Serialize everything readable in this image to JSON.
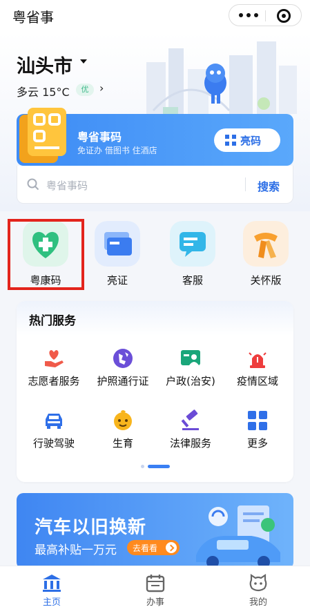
{
  "app": {
    "title": "粤省事"
  },
  "location": {
    "city": "汕头市",
    "weather": "多云 15°C",
    "air_quality": "优",
    "more": "›"
  },
  "code_card": {
    "title": "粤省事码",
    "subtitle": "免证办 借图书 住酒店",
    "button": "亮码"
  },
  "search": {
    "placeholder": "粤省事码",
    "button": "搜索"
  },
  "quick_actions": [
    {
      "label": "粤康码",
      "icon": "health-code-icon"
    },
    {
      "label": "亮证",
      "icon": "id-cards-icon"
    },
    {
      "label": "客服",
      "icon": "chat-icon"
    },
    {
      "label": "关怀版",
      "icon": "scarf-icon"
    }
  ],
  "hot_services": {
    "title": "热门服务",
    "items": [
      {
        "label": "志愿者服务",
        "icon": "heart-hand-icon"
      },
      {
        "label": "护照通行证",
        "icon": "passport-icon"
      },
      {
        "label": "户政(治安)",
        "icon": "household-icon"
      },
      {
        "label": "疫情区域",
        "icon": "alarm-light-icon"
      },
      {
        "label": "行驶驾驶",
        "icon": "car-icon"
      },
      {
        "label": "生育",
        "icon": "baby-icon"
      },
      {
        "label": "法律服务",
        "icon": "gavel-icon"
      },
      {
        "label": "更多",
        "icon": "grid-icon"
      }
    ]
  },
  "banner": {
    "title": "汽车以旧换新",
    "subtitle": "最高补贴一万元",
    "button": "去看看"
  },
  "tabs": [
    {
      "label": "主页",
      "active": true
    },
    {
      "label": "办事",
      "active": false
    },
    {
      "label": "我的",
      "active": false
    }
  ],
  "colors": {
    "accent": "#2d6fe6",
    "highlight": "#e3241c",
    "code_card": "#3d8bf5"
  }
}
